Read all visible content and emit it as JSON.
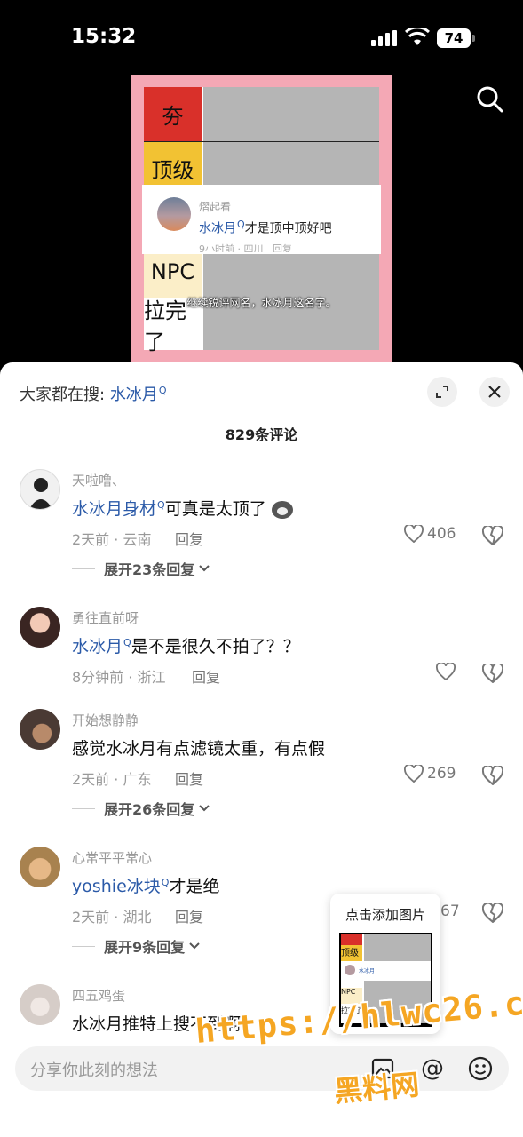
{
  "status_bar": {
    "time": "15:32",
    "battery": "74"
  },
  "video": {
    "tiers": [
      "夯",
      "顶级",
      "NPC",
      "拉完了"
    ],
    "tier_colors": [
      "#d9302a",
      "#f2c233",
      "#fbeec8",
      "#ffffff"
    ],
    "overlay_comment": {
      "user": "熠起看",
      "keyword": "水冰月",
      "text": "才是顶中顶好吧",
      "meta": "9小时前 · 四川",
      "reply": "回复"
    },
    "subtitle": "继续锐评网名，水冰月这名字。"
  },
  "sheet": {
    "search_prefix": "大家都在搜:",
    "search_keyword": "水冰月",
    "comment_count": "829条评论"
  },
  "comments": [
    {
      "user": "天啦噜、",
      "keyword": "水冰月身材",
      "text": "可真是太顶了",
      "meta": "2天前 · 云南",
      "reply": "回复",
      "likes": "406",
      "expand": "展开23条回复"
    },
    {
      "user": "勇往直前呀",
      "keyword": "水冰月",
      "text": "是不是很久不拍了？？",
      "meta": "8分钟前 · 浙江",
      "reply": "回复",
      "likes": "",
      "expand": ""
    },
    {
      "user": "开始想静静",
      "keyword": "",
      "text": "感觉水冰月有点滤镜太重，有点假",
      "meta": "2天前 · 广东",
      "reply": "回复",
      "likes": "269",
      "expand": "展开26条回复"
    },
    {
      "user": "心常平平常心",
      "keyword": "yoshie冰块",
      "text": "才是绝",
      "meta": "2天前 · 湖北",
      "reply": "回复",
      "likes": "67",
      "expand": "展开9条回复"
    },
    {
      "user": "四五鸡蛋",
      "keyword": "",
      "text": "水冰月推特上搜不到啊",
      "meta": "",
      "reply": "",
      "likes": "",
      "expand": ""
    }
  ],
  "popup": {
    "title": "点击添加图片"
  },
  "input": {
    "placeholder": "分享你此刻的想法"
  },
  "watermark": {
    "line1": "https://hlwc26.com",
    "line2": "黑料网"
  },
  "colors": {
    "link": "#2b5aa8",
    "watermark": "#f5a623",
    "video_border": "#f4a8b5"
  }
}
